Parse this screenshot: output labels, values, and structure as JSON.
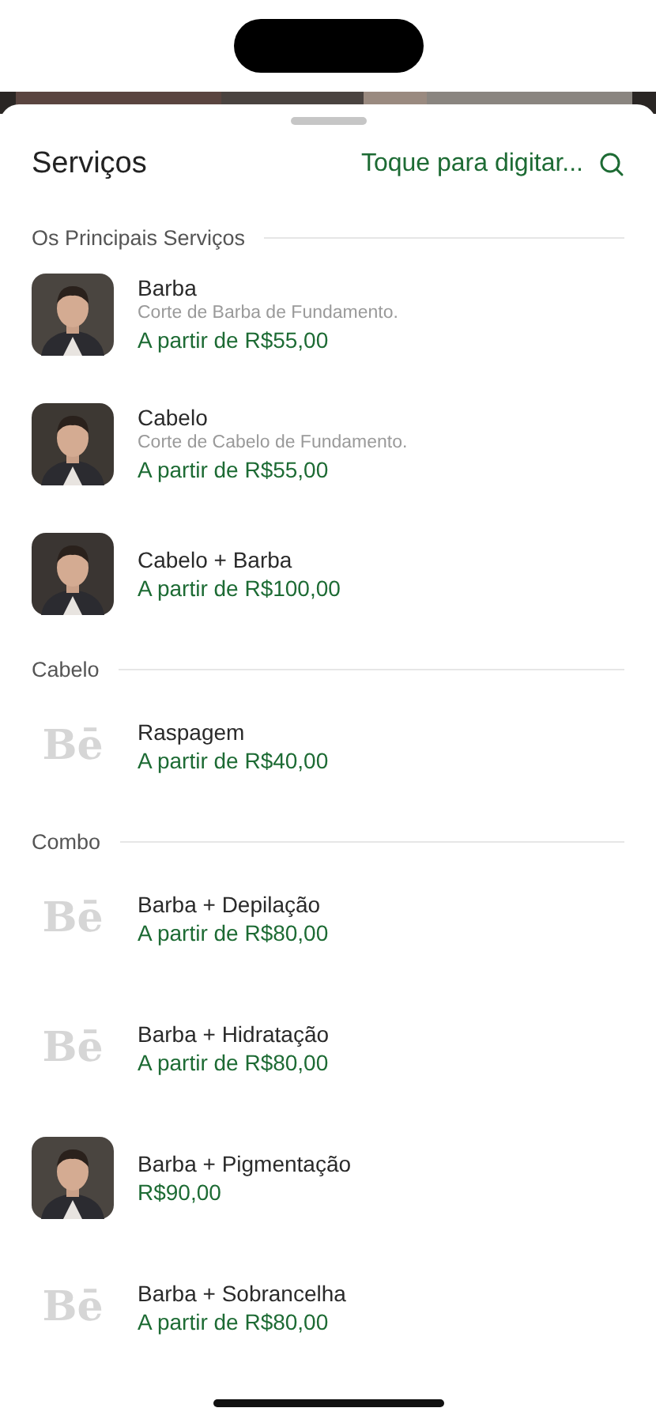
{
  "sheet": {
    "title": "Serviços",
    "search": {
      "placeholder": "Toque para digitar..."
    }
  },
  "sections": [
    {
      "title": "Os Principais Serviços",
      "items": [
        {
          "name": "Barba",
          "description": "Corte de Barba de Fundamento.",
          "price": "A partir de R$55,00"
        },
        {
          "name": "Cabelo",
          "description": "Corte de Cabelo de Fundamento.",
          "price": "A partir de R$55,00"
        },
        {
          "name": "Cabelo + Barba",
          "price": "A partir de R$100,00"
        }
      ]
    },
    {
      "title": "Cabelo",
      "items": [
        {
          "kind": "logo",
          "logo": "Bē",
          "name": "Raspagem",
          "price": "A partir de R$40,00"
        }
      ]
    },
    {
      "title": "Combo",
      "items": [
        {
          "kind": "logo",
          "logo": "Bē",
          "name": "Barba + Depilação",
          "price": "A partir de R$80,00"
        },
        {
          "kind": "logo",
          "logo": "Bē",
          "name": "Barba + Hidratação",
          "price": "A partir de R$80,00"
        },
        {
          "name": "Barba + Pigmentação",
          "price": "R$90,00"
        },
        {
          "kind": "logo",
          "logo": "Bē",
          "name": "Barba + Sobrancelha",
          "price": "A partir de R$80,00"
        }
      ]
    }
  ]
}
